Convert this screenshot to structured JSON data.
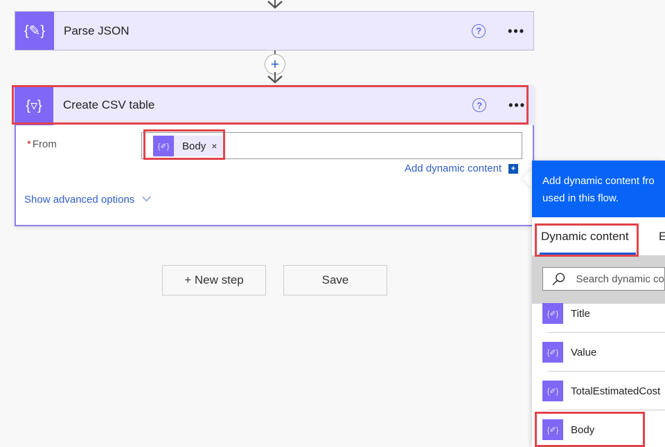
{
  "flow": {
    "parse_json": {
      "title": "Parse JSON",
      "icon": "braces-pencil-icon",
      "help": "?",
      "more": "•••"
    },
    "create_csv": {
      "title": "Create CSV table",
      "icon": "braces-filter-icon",
      "help": "?",
      "more": "•••",
      "from_label": "From",
      "required_mark": "*",
      "token": {
        "label": "Body",
        "icon": "{✐}",
        "close": "×"
      },
      "add_dynamic_content": "Add dynamic content",
      "add_dynamic_plus": "+",
      "show_advanced": "Show advanced options"
    },
    "insert_step_plus": "+",
    "icon_glyph_parse": "{✎}",
    "icon_glyph_csv": "{▿}"
  },
  "actions": {
    "new_step": "+ New step",
    "save": "Save"
  },
  "dynamic_panel": {
    "banner_line1": "Add dynamic content fro",
    "banner_line2": "used in this flow.",
    "tabs": [
      {
        "label": "Dynamic content",
        "active": true
      },
      {
        "label": "E",
        "active": false
      }
    ],
    "search_placeholder": "Search dynamic co",
    "items": [
      {
        "label": "Title",
        "icon": "{✐}"
      },
      {
        "label": "Value",
        "icon": "{✐}"
      },
      {
        "label": "TotalEstimatedCost",
        "icon": "{✐}"
      },
      {
        "label": "Body",
        "icon": "{✐}"
      }
    ]
  },
  "colors": {
    "accent_purple": "#8067f5",
    "header_lavender": "#ece8fd",
    "highlight_red": "#e2434b",
    "banner_blue": "#0764f7",
    "link_blue": "#2f5fc8"
  }
}
